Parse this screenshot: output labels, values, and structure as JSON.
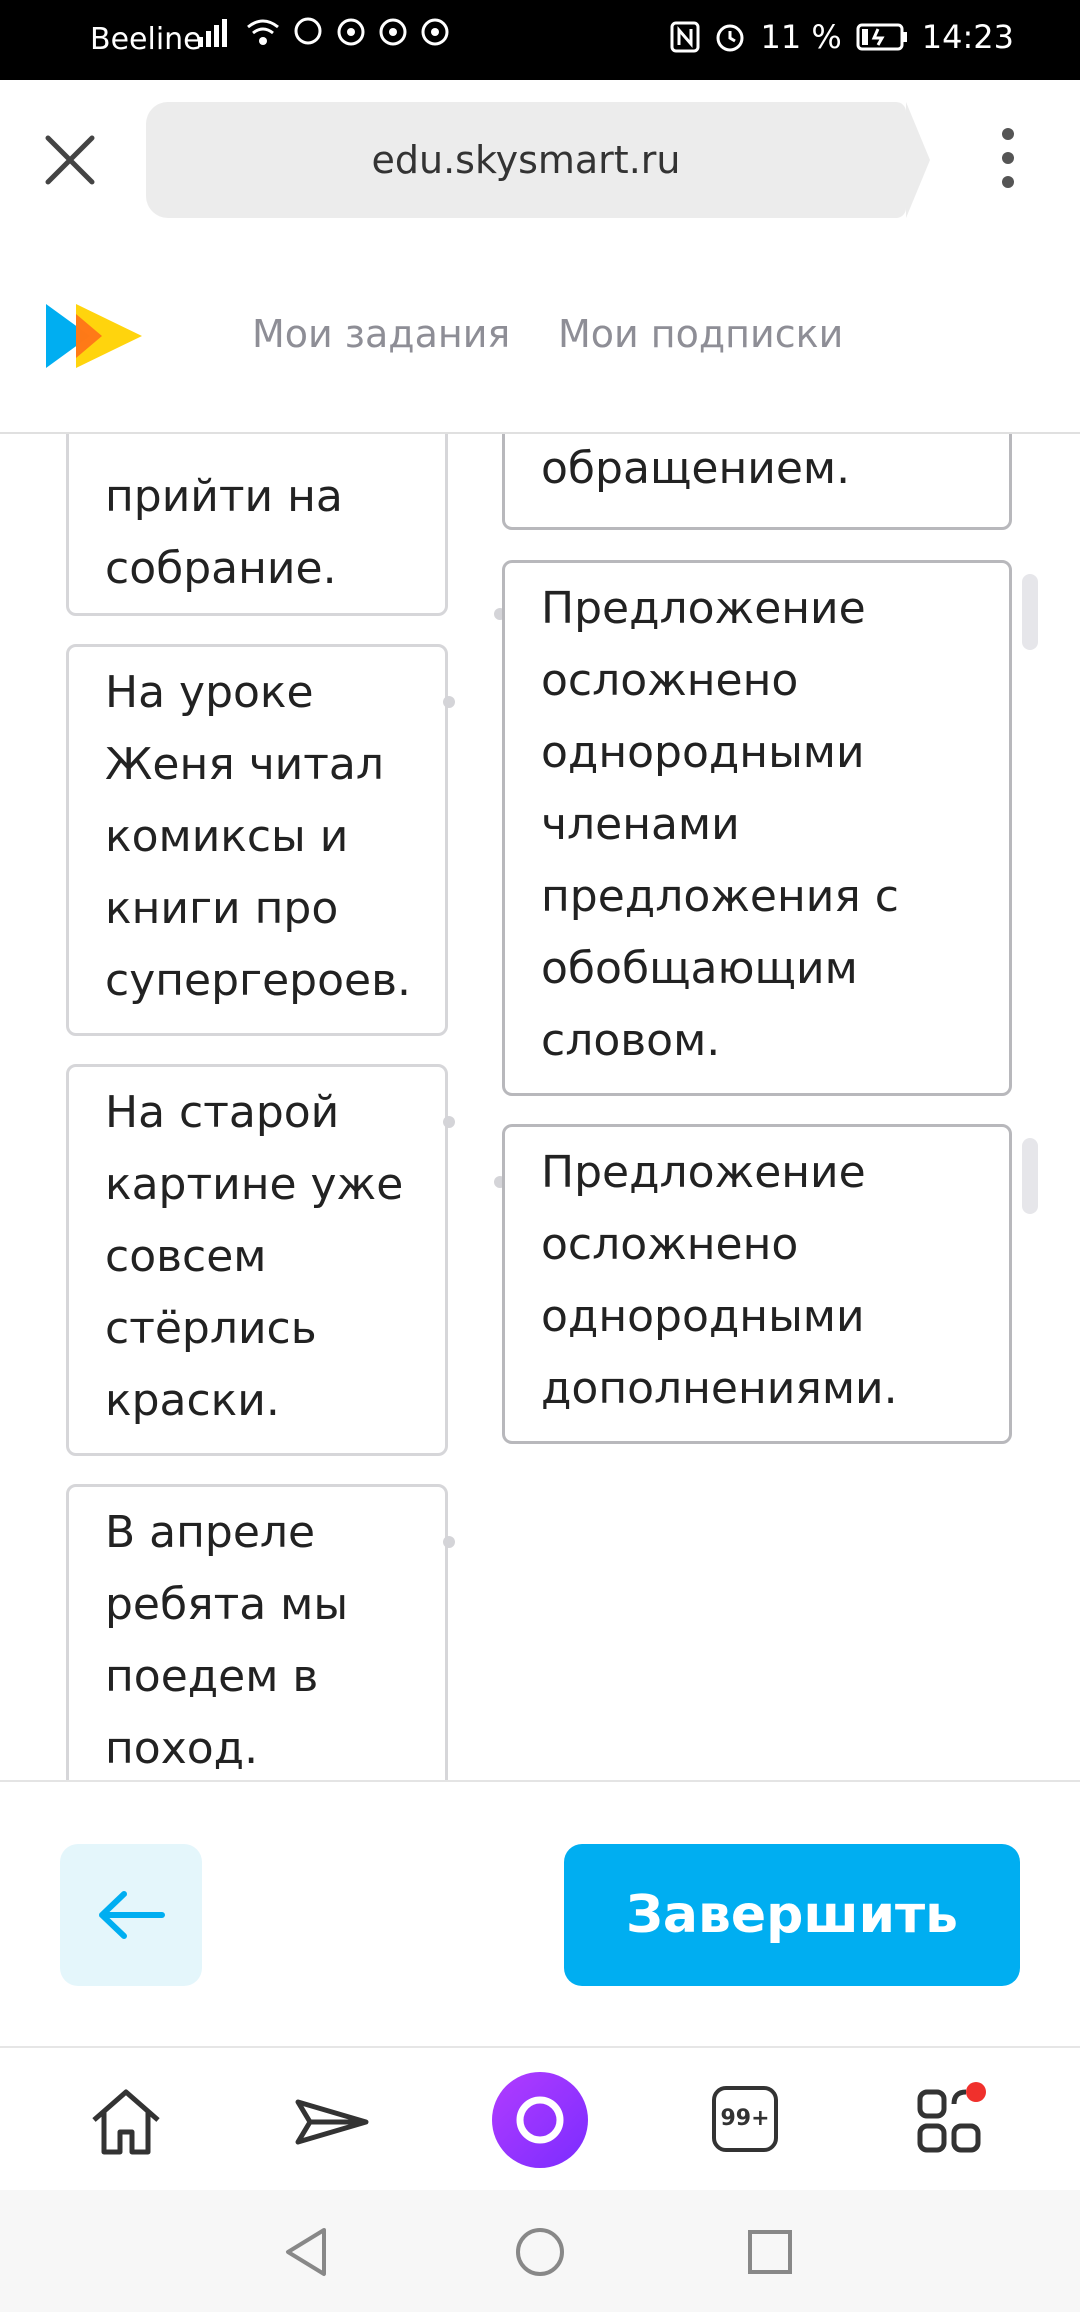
{
  "status_bar": {
    "carrier": "Beeline",
    "battery": "11 %",
    "time": "14:23"
  },
  "browser": {
    "url": "edu.skysmart.ru"
  },
  "site_header": {
    "nav": [
      "Мои задания",
      "Мои подписки"
    ]
  },
  "left_cards": [
    "прийти на собрание.",
    "На уроке Женя читал комиксы и книги про супергероев.",
    "На старой картине уже совсем стёрлись краски.",
    "В апреле ребята мы поедем в поход."
  ],
  "right_cards": [
    "обращением.",
    "Предложение осложнено однородными членами предложения с обобщающим словом.",
    "Предложение осложнено однородными дополнениями."
  ],
  "actions": {
    "finish_label": "Завершить"
  },
  "toolbar": {
    "tabs_count": "99+"
  },
  "colors": {
    "accent": "#00aef1",
    "back_button_bg": "#e4f6fb",
    "alice": "#9b34ff"
  }
}
